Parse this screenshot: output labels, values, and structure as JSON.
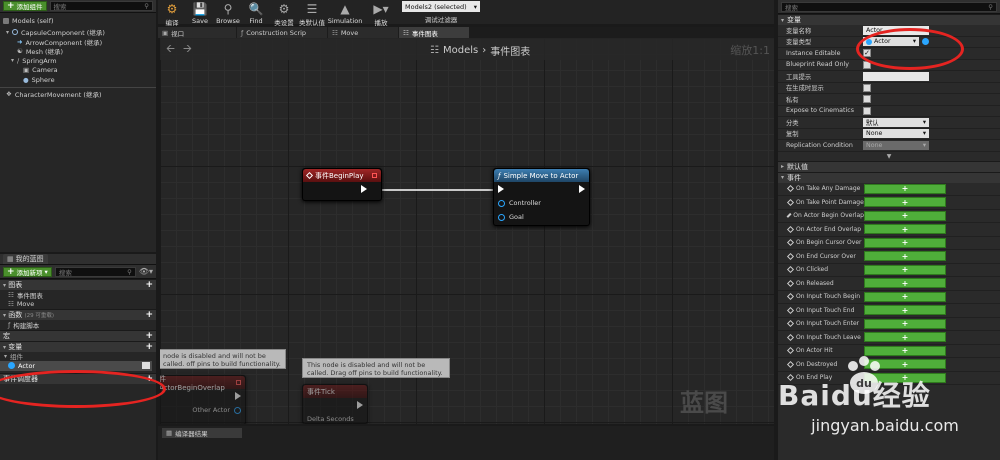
{
  "components": {
    "add_label": "添加组件",
    "search_placeholder": "搜索",
    "root": "Models (self)",
    "items": [
      {
        "label": "CapsuleComponent (继承)",
        "indent": 1
      },
      {
        "label": "ArrowComponent (继承)",
        "indent": 2
      },
      {
        "label": "Mesh (继承)",
        "indent": 2
      },
      {
        "label": "SpringArm",
        "indent": 1
      },
      {
        "label": "Camera",
        "indent": 2
      },
      {
        "label": "Sphere",
        "indent": 2
      },
      {
        "label": "CharacterMovement (继承)",
        "indent": 0
      }
    ]
  },
  "my_blueprint": {
    "tab": "我的蓝图",
    "add_label": "添加新项",
    "search_placeholder": "搜索",
    "graphs_header": "图表",
    "graphs": [
      "事件图表",
      "Move"
    ],
    "functions_header": "函数",
    "functions_count": "(29 可重载)",
    "function_items": [
      "构建脚本"
    ],
    "macros_header": "宏",
    "variables_header": "变量",
    "components_sub": "组件",
    "variable_item": "Actor",
    "dispatchers_header": "事件调度器"
  },
  "toolbar": {
    "buttons": [
      {
        "label": "编译",
        "icon": "compile-icon"
      },
      {
        "label": "Save",
        "icon": "save-icon"
      },
      {
        "label": "Browse",
        "icon": "browse-icon"
      },
      {
        "label": "Find",
        "icon": "find-icon"
      },
      {
        "label": "类设置",
        "icon": "class-settings-icon"
      },
      {
        "label": "类默认值",
        "icon": "class-defaults-icon"
      },
      {
        "label": "Simulation",
        "icon": "simulation-icon"
      },
      {
        "label": "播放",
        "icon": "play-icon"
      }
    ],
    "debug_select": "Models2 (selected)",
    "debug_label": "调试过滤器"
  },
  "tabs": [
    "视口",
    "Construction Scrip",
    "Move",
    "事件图表"
  ],
  "graph": {
    "breadcrumb_root": "Models",
    "breadcrumb_current": "事件图表",
    "zoom": "缩放1:1",
    "watermark": "蓝图",
    "node_begin_play": "事件BeginPlay",
    "node_simple_move": "Simple Move to Actor",
    "pin_controller": "Controller",
    "pin_goal": "Goal",
    "disabled_comment": "This node is disabled and will not be called. Drag off pins to build functionality.",
    "disabled_comment_partial": "node is disabled and will not be called. off pins to build functionality.",
    "node_overlap": "件 ActorBeginOverlap",
    "pin_other_actor": "Other Actor",
    "node_tick": "事件Tick",
    "pin_delta": "Delta Seconds",
    "compiler_tab": "编译器结果"
  },
  "details": {
    "search_placeholder": "搜索",
    "var_header": "变量",
    "props": [
      {
        "label": "变量名称",
        "type": "text",
        "value": "Actor"
      },
      {
        "label": "变量类型",
        "type": "type",
        "value": "Actor"
      },
      {
        "label": "Instance Editable",
        "type": "check",
        "checked": true
      },
      {
        "label": "Blueprint Read Only",
        "type": "check",
        "checked": false
      },
      {
        "label": "工具提示",
        "type": "text",
        "value": ""
      },
      {
        "label": "在生成时显示",
        "type": "check",
        "checked": false
      },
      {
        "label": "私有",
        "type": "check",
        "checked": false
      },
      {
        "label": "Expose to Cinematics",
        "type": "check",
        "checked": false
      },
      {
        "label": "分类",
        "type": "dropdown",
        "value": "默认"
      },
      {
        "label": "复制",
        "type": "dropdown",
        "value": "None"
      },
      {
        "label": "Replication Condition",
        "type": "dropdown",
        "value": "None",
        "disabled": true
      }
    ],
    "default_header": "默认值",
    "events_header": "事件",
    "events": [
      "On Take Any Damage",
      "On Take Point Damage",
      "On Actor Begin Overlap",
      "On Actor End Overlap",
      "On Begin Cursor Over",
      "On End Cursor Over",
      "On Clicked",
      "On Released",
      "On Input Touch Begin",
      "On Input Touch End",
      "On Input Touch Enter",
      "On Input Touch Leave",
      "On Actor Hit",
      "On Destroyed",
      "On End Play"
    ],
    "event_button_label": "+"
  },
  "watermark": {
    "logo": "Baidu经验",
    "url": "jingyan.baidu.com"
  },
  "colors": {
    "accent_green": "#4fae3a",
    "annotation_red": "#e52421",
    "event_node": "#8a1c1c",
    "function_node": "#2b5d86",
    "object_pin": "#2aa6ff"
  }
}
